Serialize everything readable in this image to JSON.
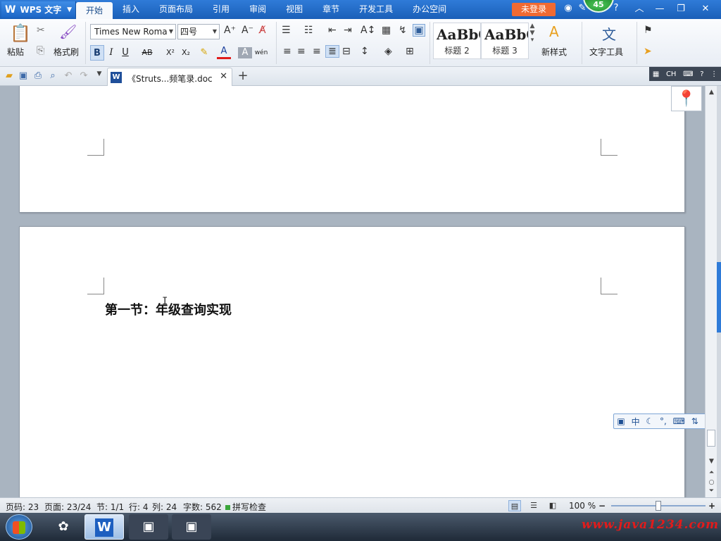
{
  "titlebar": {
    "app_name": "WPS 文字",
    "tabs": [
      "开始",
      "插入",
      "页面布局",
      "引用",
      "审阅",
      "视图",
      "章节",
      "开发工具",
      "办公空间"
    ],
    "login": "未登录",
    "badge": "45"
  },
  "ribbon": {
    "paste": "粘贴",
    "format_painter": "格式刷",
    "font_name": "Times New Roma",
    "font_size": "四号",
    "styles": [
      {
        "sample": "AaBbC",
        "name": "标题 2"
      },
      {
        "sample": "AaBbC",
        "name": "标题 3"
      }
    ],
    "new_style": "新样式",
    "text_tools": "文字工具",
    "bold": "B",
    "italic": "I",
    "underline": "U",
    "strike": "AB",
    "superscript": "X²",
    "subscript": "X₂",
    "font_color": "A",
    "phonetic": "wén"
  },
  "tabstrip": {
    "doc_title": "《Struts...频笔录.doc",
    "ime_label": "CH"
  },
  "document": {
    "heading": "第一节：年级查询实现"
  },
  "ime_bar": {
    "chinese": "中"
  },
  "statusbar": {
    "page_num": "页码: 23",
    "page_count": "页面: 23/24",
    "section": "节: 1/1",
    "row": "行: 4",
    "col": "列: 24",
    "word_count": "字数: 562",
    "spell_check": "拼写检查",
    "zoom": "100 %"
  },
  "taskbar": {
    "watermark": "www.java1234.com"
  },
  "colors": {
    "titlebar": "#2f7bd8",
    "login_button": "#f06a32",
    "accent_blue": "#2f7bd8",
    "watermark_red": "#e21b1b"
  },
  "icons": [
    "folder-open-icon",
    "save-icon",
    "print-icon",
    "print-preview-icon",
    "undo-icon",
    "redo-icon",
    "location-pin-icon",
    "gear-icon",
    "help-icon"
  ]
}
